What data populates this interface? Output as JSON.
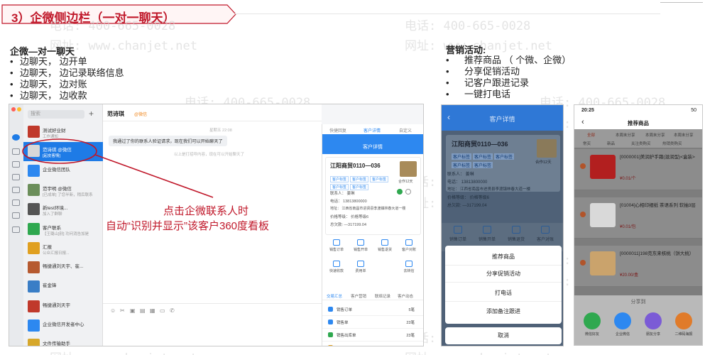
{
  "header": {
    "title": "3）企微侧边栏（一对一聊天）",
    "banner_color": "#c0182a"
  },
  "watermark": {
    "phone": "电话: 400-665-0028",
    "site": "网址: www.chanjet.net"
  },
  "left_section": {
    "title": "企微—对一聊天",
    "items": [
      "边聊天， 边开单",
      "边聊天， 边记录联络信息",
      "边聊天， 边对账",
      "边聊天， 边收款"
    ]
  },
  "right_section": {
    "title": "营销活动:",
    "items": [
      "推荐商品 （ 个微、企微）",
      "分享促销活动",
      "记客户跟进记录",
      "一键打电话"
    ]
  },
  "annotation": {
    "line1": "点击企微联系人时",
    "line2": "自动“识别并显示”该客户360度看板",
    "color": "#c0182a"
  },
  "desktop": {
    "search_placeholder": "搜索",
    "chats": [
      {
        "name": "测试好业财",
        "sub": "工作通知",
        "time": "",
        "color": "#c0392b"
      },
      {
        "name": "范诗琪 @微信",
        "sub": "[起皮客情]",
        "time": "",
        "color": "#d8d8d8",
        "active": true
      },
      {
        "name": "企业微信团队",
        "sub": "",
        "time": "",
        "color": "#2d88f0"
      },
      {
        "name": "范宇明 @微信",
        "sub": "[已成单] 了您半新，稍后联系",
        "time": "",
        "color": "#6b8e5a"
      },
      {
        "name": "新test环境...",
        "sub": "加入了群聊",
        "time": "",
        "color": "#555"
      },
      {
        "name": "客户联系",
        "sub": "【王璐山]别] 功问消告加是",
        "time": "",
        "color": "#2fa84f"
      },
      {
        "name": "汇报",
        "sub": "公众汇报日报...",
        "time": "",
        "color": "#e0a020"
      },
      {
        "name": "畅捷通刘天宇、崔...",
        "sub": "",
        "time": "",
        "color": "#b65a30"
      },
      {
        "name": "崔金锋",
        "sub": "",
        "time": "",
        "color": "#3a7ec6"
      },
      {
        "name": "畅捷通刘天宇",
        "sub": "",
        "time": "",
        "color": "#c0392b"
      },
      {
        "name": "企业微信开发者中心",
        "sub": "",
        "time": "",
        "color": "#2d88f0"
      },
      {
        "name": "文件传输助手",
        "sub": "",
        "time": "",
        "color": "#d6a72a"
      }
    ],
    "conversation": {
      "contact_name": "范诗琪",
      "contact_tag": "@微信",
      "time": "星期五 22:08",
      "message": "我通过了你的联系人验证请求，现在我们可以开始聊天了",
      "system_note": "以上是打招呼内容，现在可以开始聊天了"
    },
    "sidebar": {
      "tabs": [
        "快捷回复",
        "客户详情",
        "自定义"
      ],
      "title": "客户详情",
      "customer": "江阳商贸0110—036",
      "tags": [
        "客户标签",
        "客户标签",
        "客户标签"
      ],
      "tags2": [
        "客户标签",
        "客户标签"
      ],
      "photo_caption": "合作12天",
      "contact": "联系人： 姜琳",
      "phone": "电话： 13813800000",
      "address": "地址： 江西省南昌市进贤县李渡镇林春大道一楼",
      "price_level": "价格等级： 价格等级6",
      "total_due": "总欠款: —317199.04",
      "actions": [
        "销售订单",
        "销售开单",
        "销售退货",
        "客户对账",
        "快速收款",
        "费用单",
        "",
        "去转信"
      ],
      "stats_tabs": [
        "交易汇总",
        "客户营销",
        "联络记录",
        "客户动态"
      ],
      "stats": [
        {
          "label": "销售订单",
          "value": "5笔",
          "color": "#2d88f0"
        },
        {
          "label": "销售单",
          "value": "23笔",
          "color": "#2d88f0"
        },
        {
          "label": "销售出库单",
          "value": "23笔",
          "color": "#2fa84f"
        },
        {
          "label": "费用单",
          "value": "345笔",
          "color": "#e0a020"
        }
      ]
    }
  },
  "phone1": {
    "title": "客户详情",
    "customer": "江阳商贸0110—036",
    "tags": [
      "客户标签",
      "客户标签",
      "客户标签"
    ],
    "tags2": [
      "客户标签",
      "客户标签"
    ],
    "photo_caption": "合作12天",
    "contact": "联系人： 姜琳",
    "phone": "电话： 13813800000",
    "address": "地址： 江西省南昌市进贤县李渡镇林春大道一楼",
    "price_level": "价格等级： 价格等级6",
    "total_due": "总欠款: —317199.04",
    "actions": [
      "销售订单",
      "销售开单",
      "销售退货",
      "客户对账"
    ],
    "sheet": [
      "推荐商品",
      "分享促销活动",
      "打电话",
      "添加备注跟进"
    ],
    "cancel": "取消"
  },
  "phone2": {
    "time": "20:25",
    "battery": "50",
    "title": "推荐商品",
    "tabs": [
      "全部",
      "本周末分享",
      "本周末分享",
      "本周末分享"
    ],
    "subtabs": [
      "常买",
      "新品",
      "关注类购买",
      "热销类购买"
    ],
    "products": [
      {
        "name": "[0000001]美润护手霜(滋润型)<盒装>",
        "price": "¥0.01/个",
        "color": "#b21f1f"
      },
      {
        "name": "[01004]心相印细纸 茶语系列 软抽3层",
        "price": "¥0.01/包",
        "color": "#d9d9d9"
      },
      {
        "name": "[0000011]198克东来核桃（饼大桃）",
        "price": "¥20.00/盒",
        "color": "#caa36c"
      }
    ],
    "share_title": "分享到",
    "share": [
      {
        "label": "微信好友",
        "color": "#2fa84f"
      },
      {
        "label": "企业微信",
        "color": "#2d88f0"
      },
      {
        "label": "朋友分享",
        "color": "#7b5bd6"
      },
      {
        "label": "二维码海报",
        "color": "#e07b2a"
      }
    ]
  }
}
